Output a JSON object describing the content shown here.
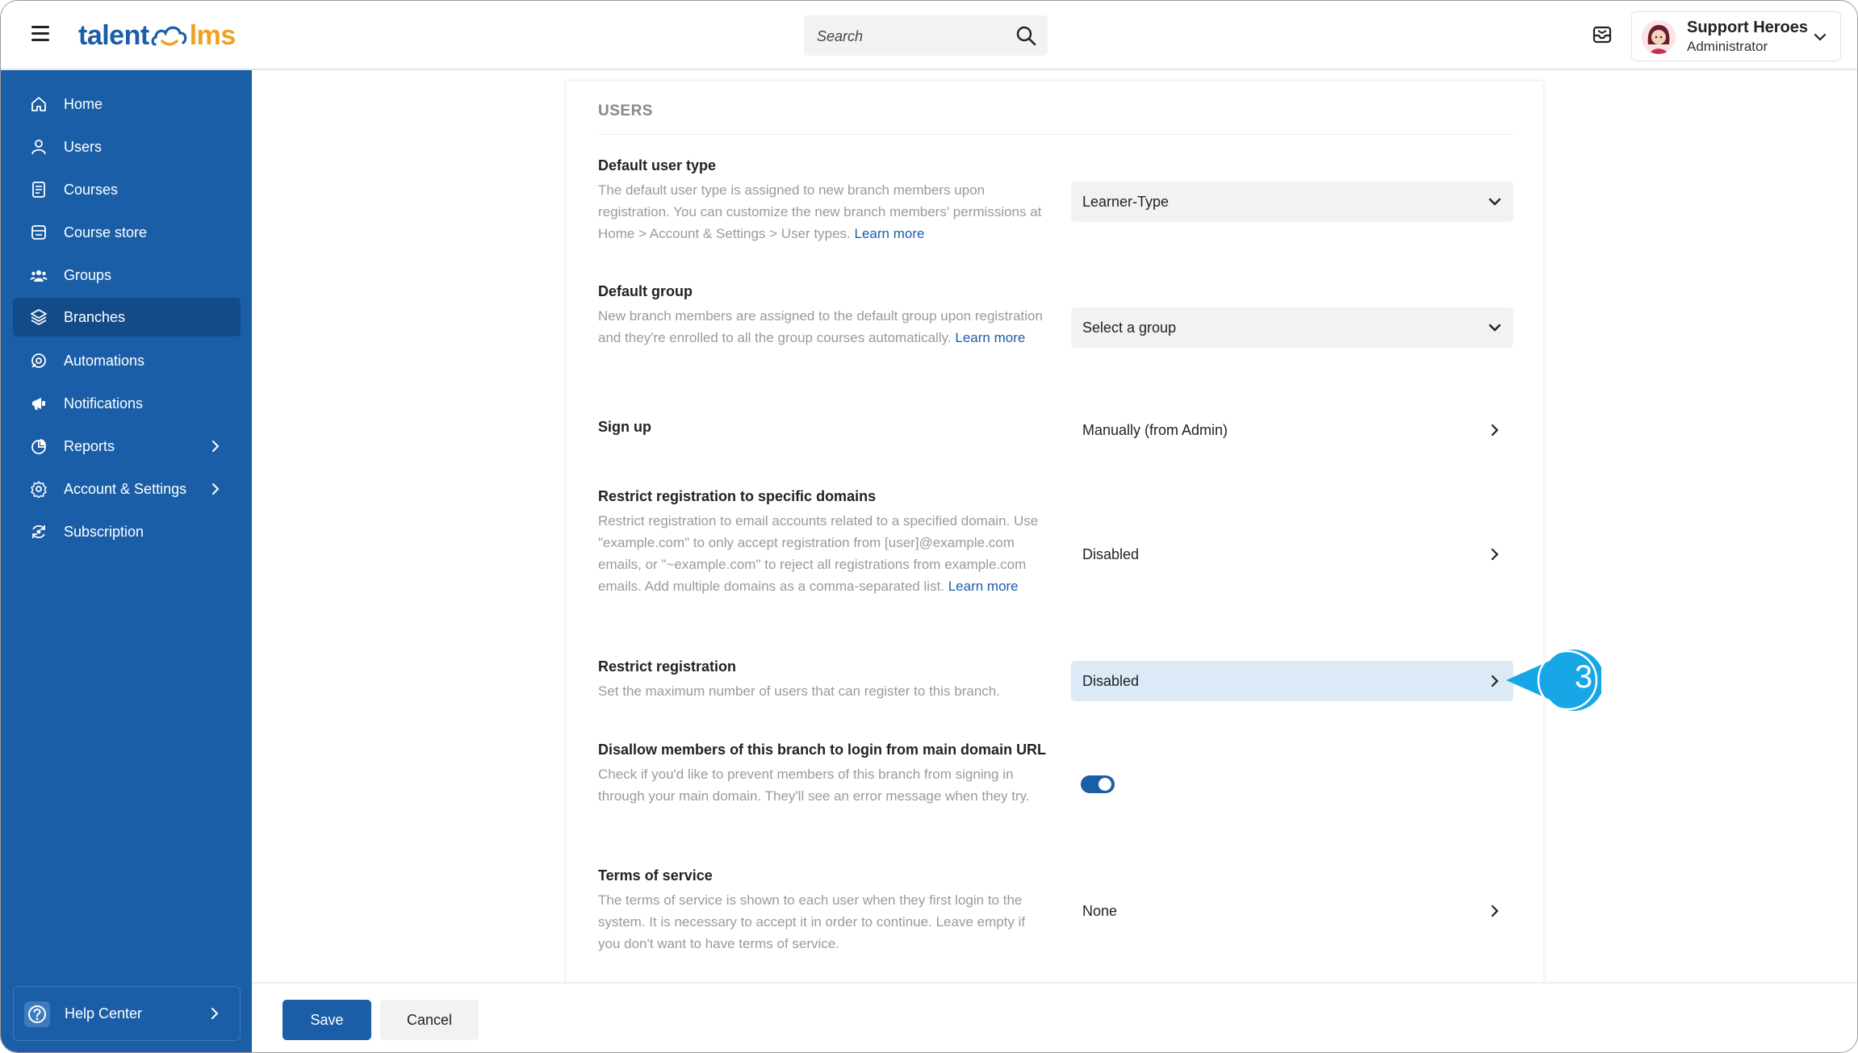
{
  "app": {
    "logo_left": "talent",
    "logo_right": "lms"
  },
  "search": {
    "placeholder": "Search"
  },
  "user": {
    "name": "Support Heroes",
    "role": "Administrator"
  },
  "sidebar": {
    "items": [
      {
        "label": "Home",
        "icon": "home-icon"
      },
      {
        "label": "Users",
        "icon": "user-icon"
      },
      {
        "label": "Courses",
        "icon": "courses-icon"
      },
      {
        "label": "Course store",
        "icon": "store-icon"
      },
      {
        "label": "Groups",
        "icon": "groups-icon"
      },
      {
        "label": "Branches",
        "icon": "layers-icon",
        "active": true
      },
      {
        "label": "Automations",
        "icon": "automation-icon"
      },
      {
        "label": "Notifications",
        "icon": "megaphone-icon"
      },
      {
        "label": "Reports",
        "icon": "pie-chart-icon",
        "has_submenu": true
      },
      {
        "label": "Account & Settings",
        "icon": "gear-icon",
        "has_submenu": true
      },
      {
        "label": "Subscription",
        "icon": "subscription-icon"
      }
    ],
    "help_label": "Help Center"
  },
  "section": {
    "title": "USERS"
  },
  "settings": {
    "default_user_type": {
      "title": "Default user type",
      "description": "The default user type is assigned to new branch members upon registration. You can customize the new branch members' permissions at Home > Account & Settings > User types.",
      "link": "Learn more",
      "value": "Learner-Type"
    },
    "default_group": {
      "title": "Default group",
      "description": "New branch members are assigned to the default group upon registration and they're enrolled to all the group courses automatically.",
      "link": "Learn more",
      "value": "Select a group"
    },
    "sign_up": {
      "title": "Sign up",
      "value": "Manually (from Admin)"
    },
    "restrict_domains": {
      "title": "Restrict registration to specific domains",
      "description": "Restrict registration to email accounts related to a specified domain. Use \"example.com\" to only accept registration from [user]@example.com emails, or \"~example.com\" to reject all registrations from example.com emails. Add multiple domains as a comma-separated list.",
      "link": "Learn more",
      "value": "Disabled"
    },
    "restrict_registration": {
      "title": "Restrict registration",
      "description": "Set the maximum number of users that can register to this branch.",
      "value": "Disabled"
    },
    "disallow_main_domain": {
      "title": "Disallow members of this branch to login from main domain URL",
      "description": "Check if you'd like to prevent members of this branch from signing in through your main domain. They'll see an error message when they try.",
      "enabled": true
    },
    "terms_of_service": {
      "title": "Terms of service",
      "description": "The terms of service is shown to each user when they first login to the system. It is necessary to accept it in order to continue. Leave empty if you don't want to have terms of service.",
      "value": "None"
    }
  },
  "callout": {
    "number": "3"
  },
  "footer": {
    "save_label": "Save",
    "cancel_label": "Cancel"
  },
  "colors": {
    "brand_blue": "#1a5ea8",
    "sidebar_active": "#134b89",
    "accent_orange": "#f2a01f",
    "callout": "#17a7e6",
    "highlight_row": "#dce9f7"
  }
}
